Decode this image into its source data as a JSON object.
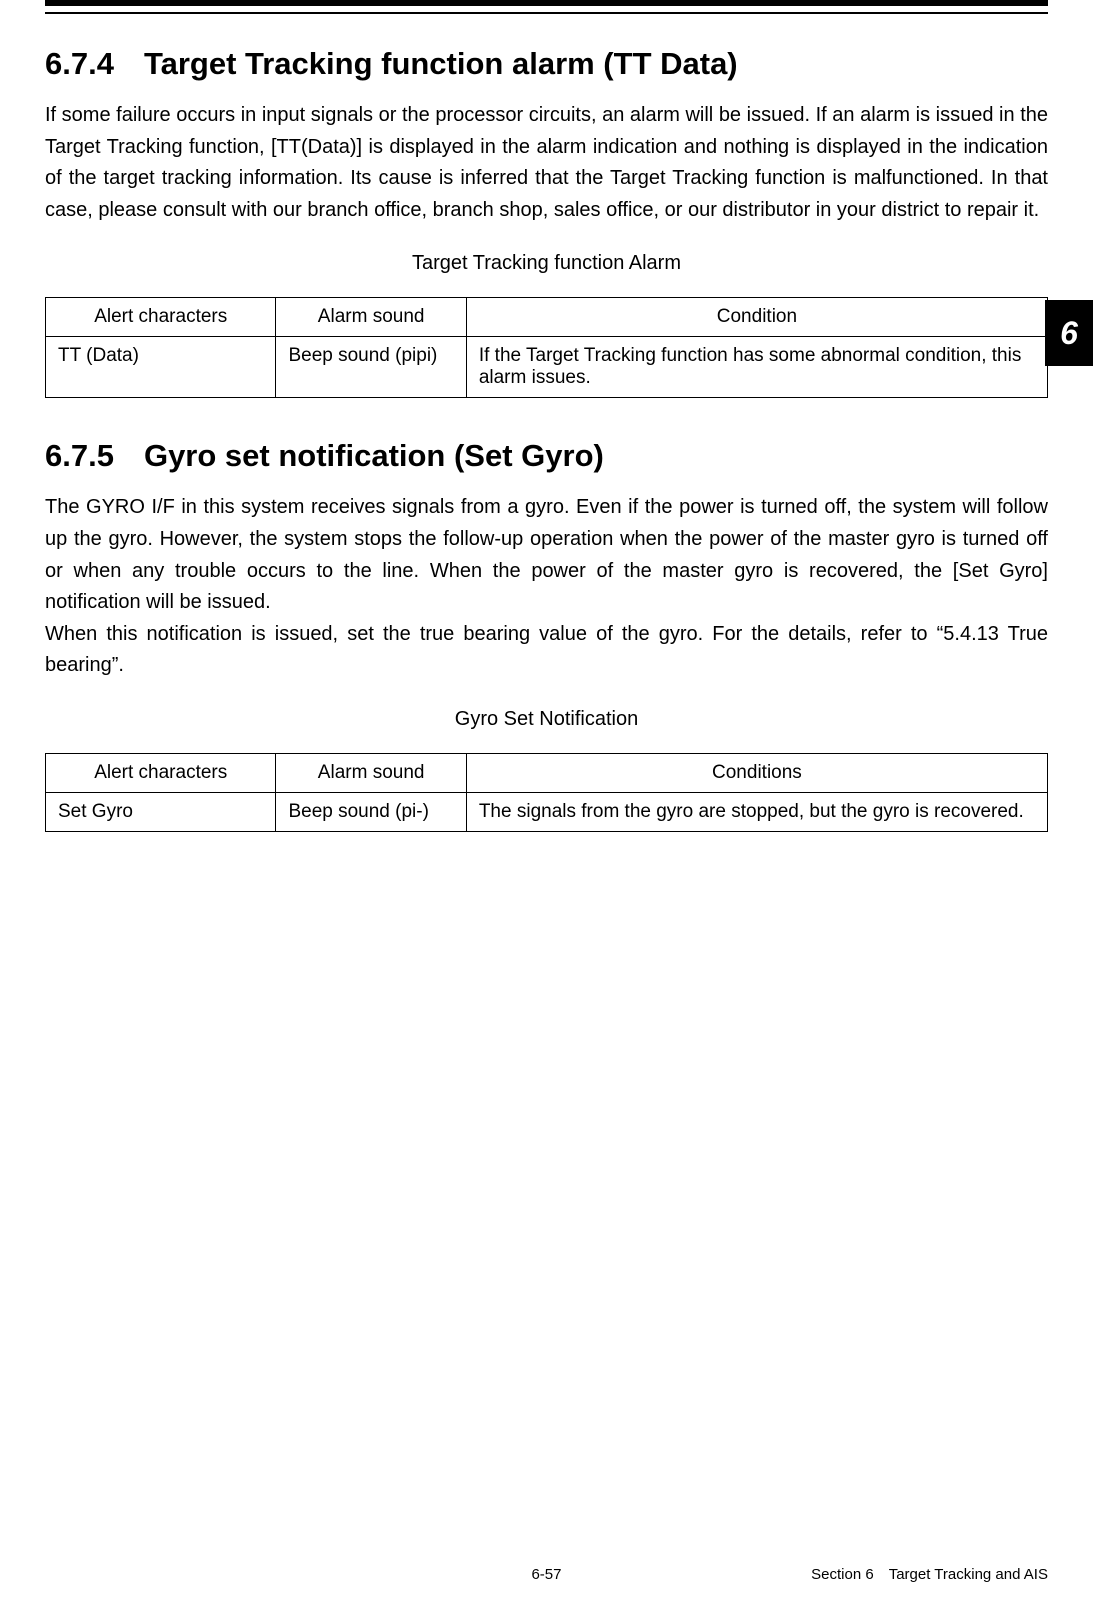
{
  "side_tab": "6",
  "section_674": {
    "num": "6.7.4",
    "title": "Target Tracking function alarm (TT Data)",
    "body": "If some failure occurs in input signals or the processor circuits, an alarm will be issued. If an alarm is issued in the Target Tracking function, [TT(Data)] is displayed in the alarm indication and nothing is displayed in the indication of the target tracking information. Its cause is inferred that the Target Tracking function is malfunctioned. In that case, please consult with our branch office, branch shop, sales office, or our distributor in your district to repair it.",
    "table_caption": "Target Tracking function Alarm",
    "table": {
      "headers": [
        "Alert characters",
        "Alarm sound",
        "Condition"
      ],
      "row": {
        "alert": "TT (Data)",
        "sound": "Beep sound (pipi)",
        "condition": "If the Target Tracking function has some abnormal condition, this alarm issues."
      }
    }
  },
  "section_675": {
    "num": "6.7.5",
    "title": "Gyro set notification (Set Gyro)",
    "body1": "The GYRO I/F in this system receives signals from a gyro. Even if the power is turned off, the system will follow up the gyro. However, the system stops the follow-up operation when the power of the master gyro is turned off or when any trouble occurs to the line. When the power of the master gyro is recovered, the [Set Gyro] notification will be issued.",
    "body2": "When this notification is issued, set the true bearing value of the gyro. For the details, refer to “5.4.13 True bearing”.",
    "table_caption": "Gyro Set Notification",
    "table": {
      "headers": [
        "Alert characters",
        "Alarm sound",
        "Conditions"
      ],
      "row": {
        "alert": "Set Gyro",
        "sound": "Beep sound (pi-)",
        "condition": "The signals from the gyro are stopped, but the gyro is recovered."
      }
    }
  },
  "footer": {
    "page": "6-57",
    "section_name": "Section 6 Target Tracking and AIS"
  }
}
